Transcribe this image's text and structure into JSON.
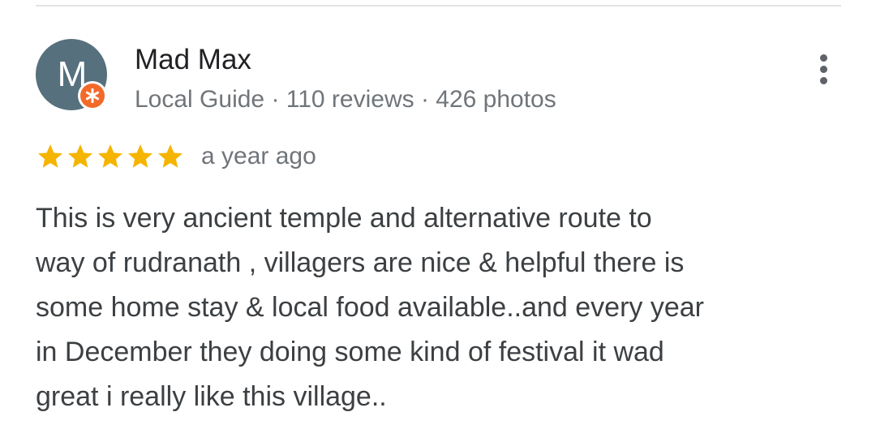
{
  "author": {
    "avatar_letter": "M",
    "name": "Mad Max",
    "meta": "Local Guide · 110 reviews · 426 photos",
    "avatar_color": "#57707d",
    "badge_color": "#f26a2a"
  },
  "review": {
    "rating": 5,
    "max_rating": 5,
    "star_color": "#f5b400",
    "time": "a year ago",
    "text_lines": [
      "This is very ancient temple and alternative route to",
      "way of rudranath , villagers are nice & helpful there is",
      "some home stay & local food available..and every year",
      "in December they doing some kind of festival it wad",
      "great i really like this village.."
    ]
  },
  "actions": {
    "more_icon": "more-vertical-icon"
  }
}
